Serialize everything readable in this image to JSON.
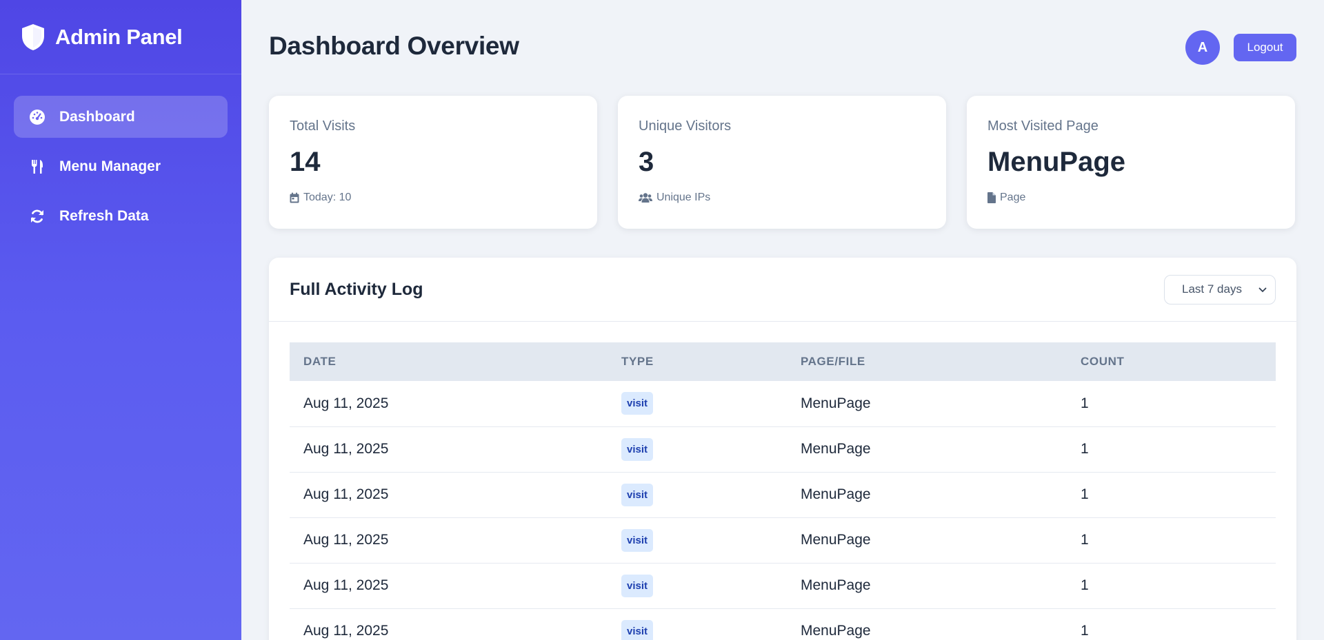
{
  "sidebar": {
    "brand": "Admin Panel",
    "items": [
      {
        "label": "Dashboard",
        "icon": "gauge-icon",
        "active": true
      },
      {
        "label": "Menu Manager",
        "icon": "utensils-icon",
        "active": false
      },
      {
        "label": "Refresh Data",
        "icon": "refresh-icon",
        "active": false
      }
    ]
  },
  "header": {
    "title": "Dashboard Overview",
    "avatar_initial": "A",
    "logout_label": "Logout"
  },
  "stats": [
    {
      "label": "Total Visits",
      "value": "14",
      "sub": "Today: 10",
      "icon": "calendar-icon"
    },
    {
      "label": "Unique Visitors",
      "value": "3",
      "sub": "Unique IPs",
      "icon": "users-icon"
    },
    {
      "label": "Most Visited Page",
      "value": "MenuPage",
      "sub": "Page",
      "icon": "file-icon"
    }
  ],
  "activity_log": {
    "title": "Full Activity Log",
    "range": "Last 7 days",
    "columns": [
      "DATE",
      "TYPE",
      "PAGE/FILE",
      "COUNT"
    ],
    "rows": [
      {
        "date": "Aug 11, 2025",
        "type": "visit",
        "page": "MenuPage",
        "count": "1"
      },
      {
        "date": "Aug 11, 2025",
        "type": "visit",
        "page": "MenuPage",
        "count": "1"
      },
      {
        "date": "Aug 11, 2025",
        "type": "visit",
        "page": "MenuPage",
        "count": "1"
      },
      {
        "date": "Aug 11, 2025",
        "type": "visit",
        "page": "MenuPage",
        "count": "1"
      },
      {
        "date": "Aug 11, 2025",
        "type": "visit",
        "page": "MenuPage",
        "count": "1"
      },
      {
        "date": "Aug 11, 2025",
        "type": "visit",
        "page": "MenuPage",
        "count": "1"
      }
    ]
  },
  "colors": {
    "sidebar_top": "#4f46e5",
    "sidebar_bottom": "#6366f1",
    "accent": "#6366f1",
    "badge_bg": "#dbeafe",
    "badge_text": "#1e40af"
  }
}
